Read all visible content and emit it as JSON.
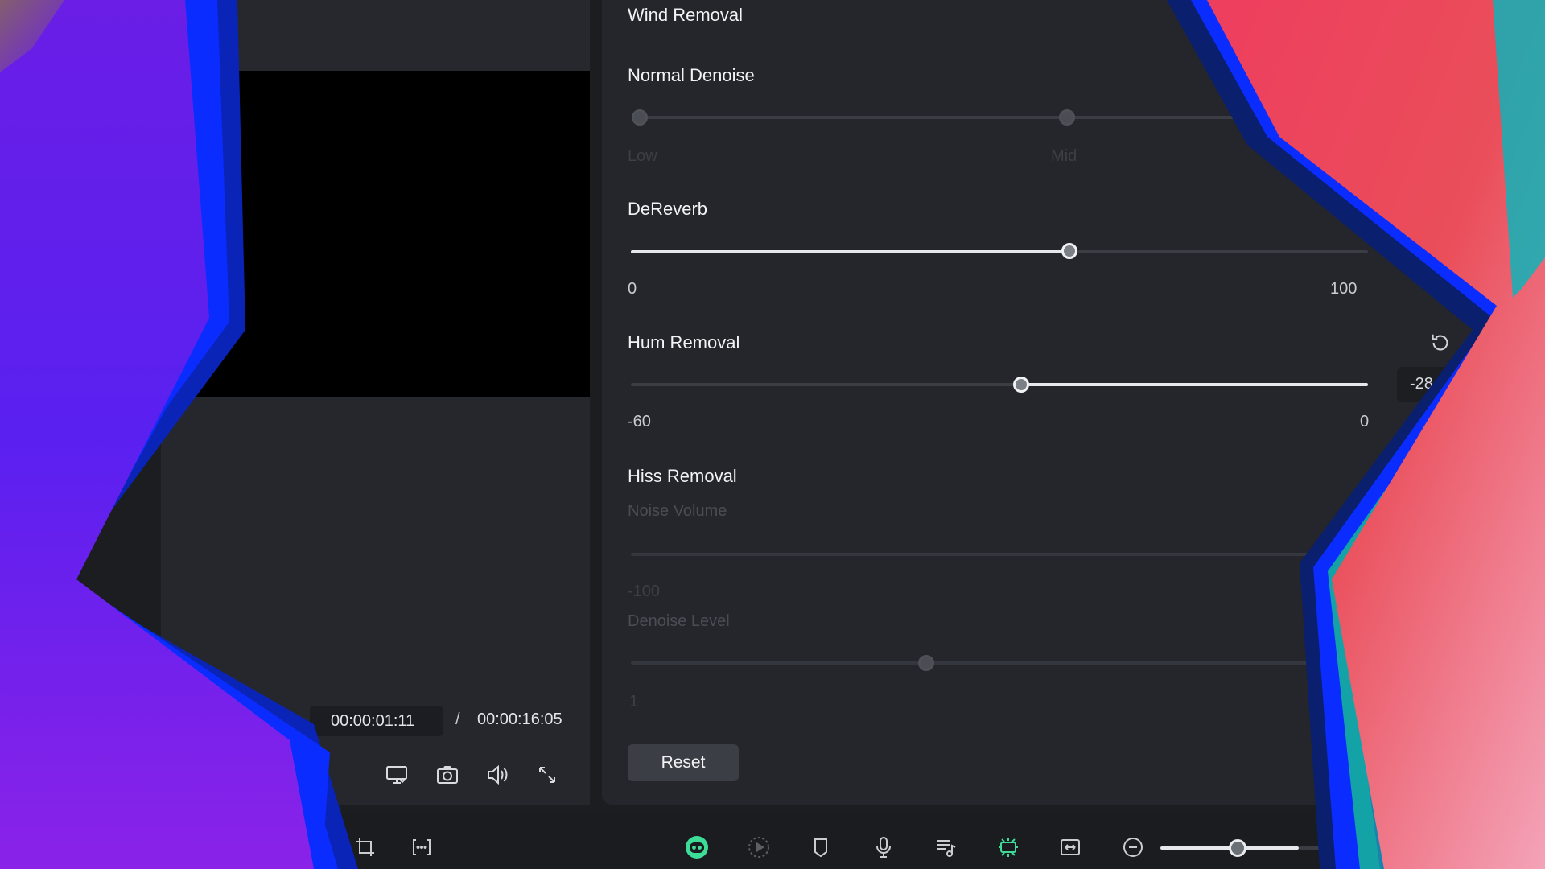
{
  "preview": {
    "timecode_current": "00:00:01:11",
    "timecode_separator": "/",
    "timecode_total": "00:00:16:05",
    "controls": [
      {
        "name": "render-preview-icon"
      },
      {
        "name": "snapshot-icon"
      },
      {
        "name": "volume-icon"
      },
      {
        "name": "fullscreen-icon"
      }
    ]
  },
  "denoise": {
    "wind_removal": {
      "title": "Wind Removal"
    },
    "normal_denoise": {
      "title": "Normal Denoise",
      "label_low": "Low",
      "label_mid": "Mid",
      "level_fraction": 0.0
    },
    "dereverb": {
      "title": "DeReverb",
      "min": "0",
      "max": "100",
      "value": 60
    },
    "hum_removal": {
      "title": "Hum Removal",
      "min": "-60",
      "max": "0",
      "value": "-28"
    },
    "hiss_removal": {
      "title": "Hiss Removal",
      "noise_volume": {
        "label": "Noise Volume",
        "min": "-100"
      },
      "denoise_level": {
        "label": "Denoise Level",
        "min": "1"
      }
    },
    "reset_label": "Reset"
  },
  "toolbar": {
    "items": [
      "ai-copilot-icon",
      "play-range-icon",
      "marker-icon",
      "microphone-icon",
      "audio-list-icon",
      "auto-highlight-icon",
      "fit-timeline-icon",
      "zoom-out-icon"
    ],
    "zoom_level_fraction": 0.5
  },
  "colors": {
    "panel_bg": "#24262b",
    "accent_green": "#3ddc97",
    "overlay_purple": "#6a1ee6",
    "overlay_blue": "#0a2fff",
    "overlay_pink": "#ee3e5e"
  }
}
